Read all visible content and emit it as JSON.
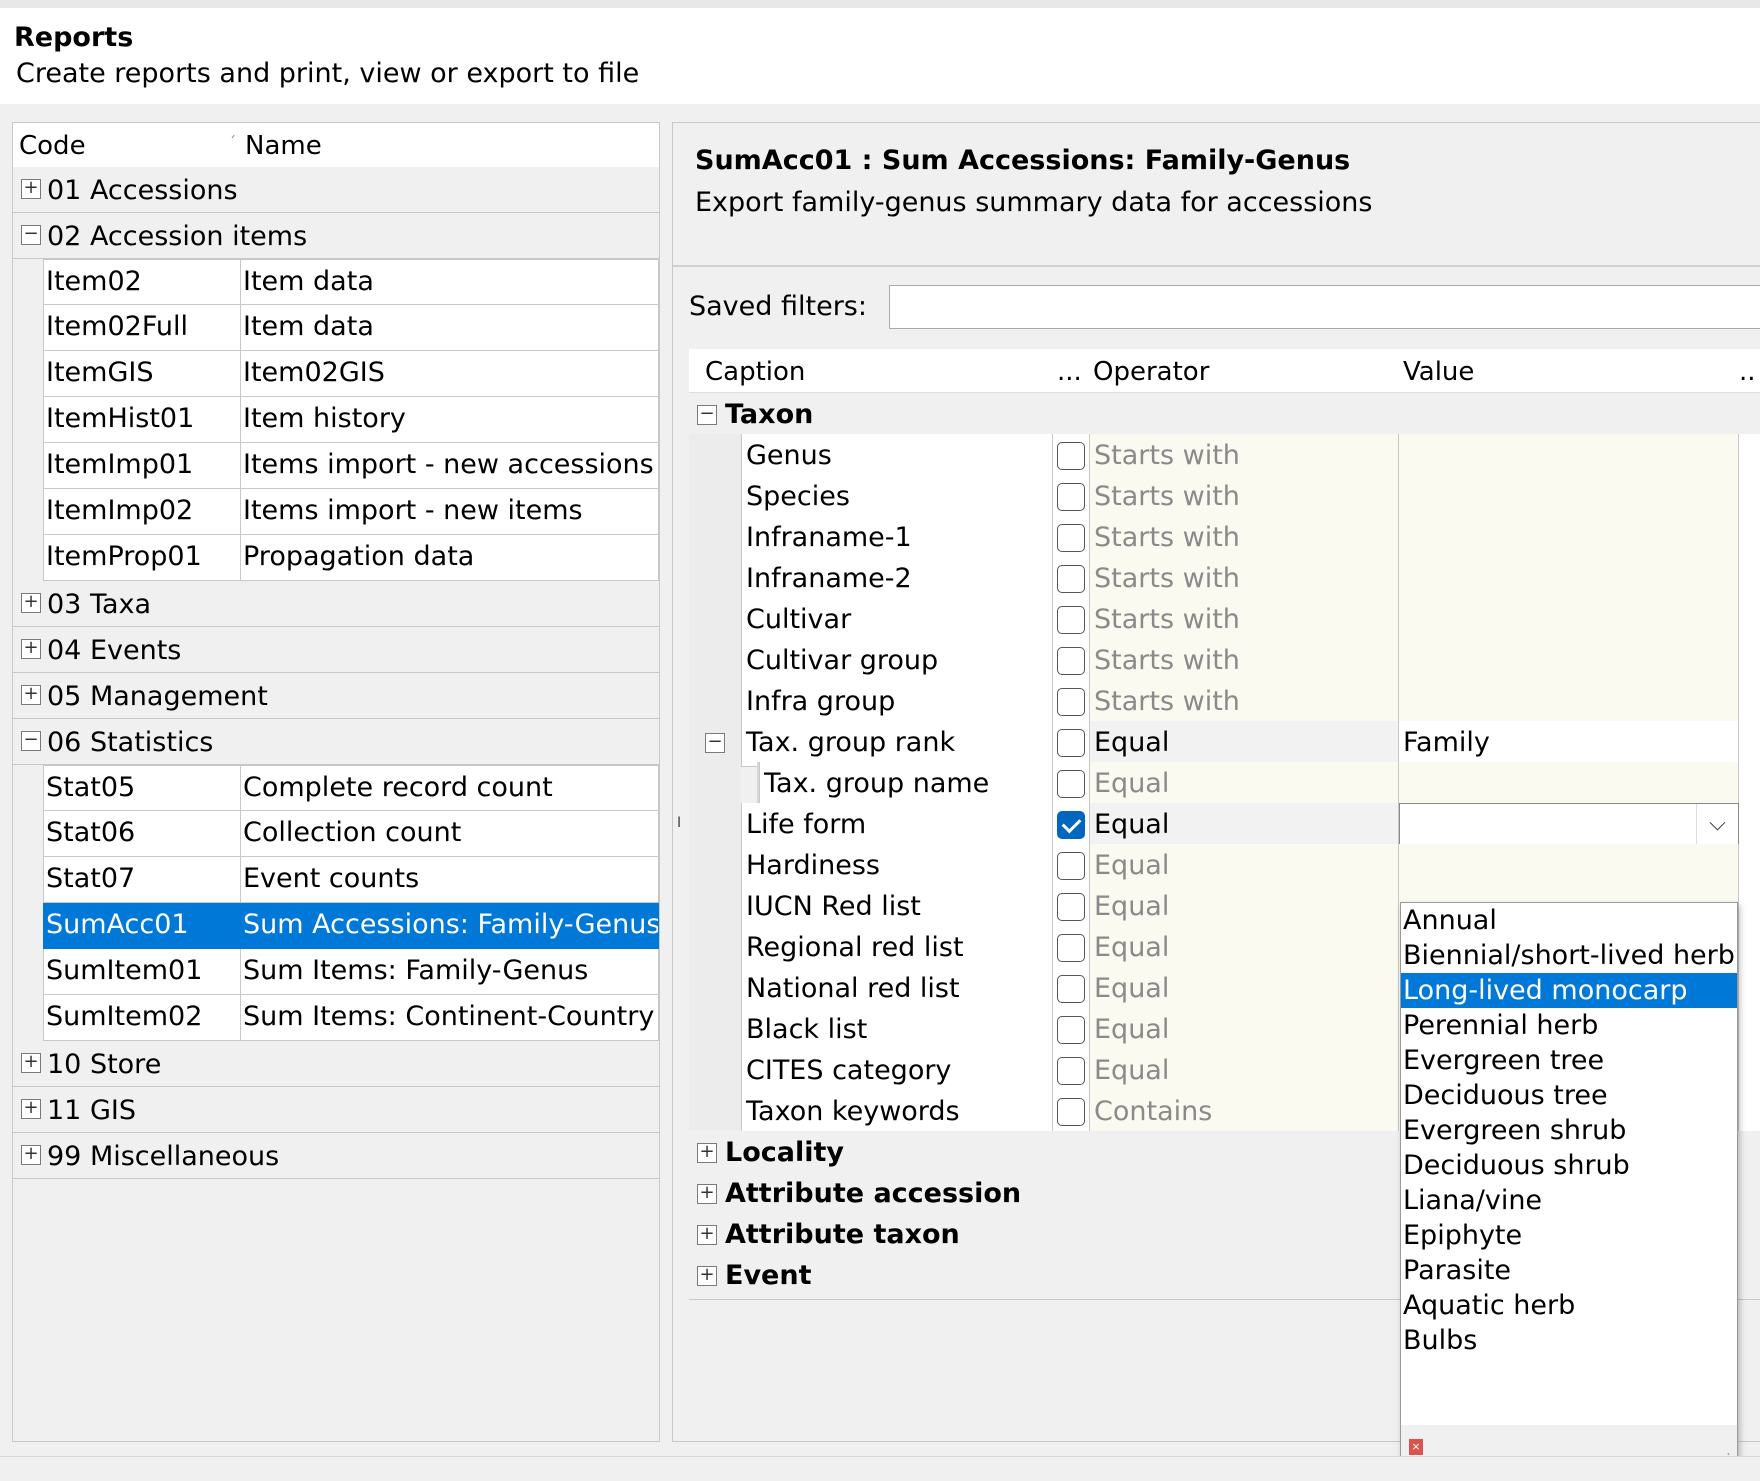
{
  "header": {
    "title": "Reports",
    "subtitle": "Create reports and print, view or export to file"
  },
  "report_list": {
    "columns": {
      "code": "Code",
      "sep": "ˊ",
      "name": "Name"
    },
    "groups": [
      {
        "label": "01 Accessions",
        "expanded": false,
        "items": []
      },
      {
        "label": "02 Accession items",
        "expanded": true,
        "items": [
          {
            "code": "Item02",
            "name": "Item data"
          },
          {
            "code": "Item02Full",
            "name": "Item data"
          },
          {
            "code": "ItemGIS",
            "name": "Item02GIS"
          },
          {
            "code": "ItemHist01",
            "name": "Item history"
          },
          {
            "code": "ItemImp01",
            "name": "Items import - new accessions"
          },
          {
            "code": "ItemImp02",
            "name": "Items import - new items"
          },
          {
            "code": "ItemProp01",
            "name": "Propagation data"
          }
        ]
      },
      {
        "label": "03 Taxa",
        "expanded": false,
        "items": []
      },
      {
        "label": "04 Events",
        "expanded": false,
        "items": []
      },
      {
        "label": "05 Management",
        "expanded": false,
        "items": []
      },
      {
        "label": "06 Statistics",
        "expanded": true,
        "items": [
          {
            "code": "Stat05",
            "name": "Complete record count"
          },
          {
            "code": "Stat06",
            "name": "Collection count"
          },
          {
            "code": "Stat07",
            "name": "Event counts"
          },
          {
            "code": "SumAcc01",
            "name": "Sum Accessions: Family-Genus",
            "selected": true
          },
          {
            "code": "SumItem01",
            "name": "Sum Items: Family-Genus"
          },
          {
            "code": "SumItem02",
            "name": "Sum Items: Continent-Country"
          }
        ]
      },
      {
        "label": "10 Store",
        "expanded": false,
        "items": []
      },
      {
        "label": "11 GIS",
        "expanded": false,
        "items": []
      },
      {
        "label": "99 Miscellaneous",
        "expanded": false,
        "items": []
      }
    ]
  },
  "detail": {
    "title": "SumAcc01 : Sum Accessions: Family-Genus",
    "description": "Export family-genus summary data for accessions",
    "saved_filters_label": "Saved filters:",
    "saved_filters_value": ""
  },
  "filter_grid": {
    "columns": {
      "caption": "Caption",
      "dots": "...",
      "operator": "Operator",
      "value": "Value",
      "dots2": ".."
    },
    "taxon_label": "Taxon",
    "taxon_rows": [
      {
        "caption": "Genus",
        "checked": false,
        "operator": "Starts with",
        "value": ""
      },
      {
        "caption": "Species",
        "checked": false,
        "operator": "Starts with",
        "value": ""
      },
      {
        "caption": "Infraname-1",
        "checked": false,
        "operator": "Starts with",
        "value": ""
      },
      {
        "caption": "Infraname-2",
        "checked": false,
        "operator": "Starts with",
        "value": ""
      },
      {
        "caption": "Cultivar",
        "checked": false,
        "operator": "Starts with",
        "value": ""
      },
      {
        "caption": "Cultivar group",
        "checked": false,
        "operator": "Starts with",
        "value": ""
      },
      {
        "caption": "Infra group",
        "checked": false,
        "operator": "Starts with",
        "value": ""
      },
      {
        "caption": "Tax. group rank",
        "checked": false,
        "operator": "Equal",
        "value": "Family"
      },
      {
        "caption": "Tax. group name",
        "checked": false,
        "operator": "Equal",
        "value": ""
      },
      {
        "caption": "Life form",
        "checked": true,
        "operator": "Equal",
        "value": ""
      },
      {
        "caption": "Hardiness",
        "checked": false,
        "operator": "Equal",
        "value": ""
      },
      {
        "caption": "IUCN Red list",
        "checked": false,
        "operator": "Equal",
        "value": ""
      },
      {
        "caption": "Regional red list",
        "checked": false,
        "operator": "Equal",
        "value": ""
      },
      {
        "caption": "National red list",
        "checked": false,
        "operator": "Equal",
        "value": ""
      },
      {
        "caption": "Black list",
        "checked": false,
        "operator": "Equal",
        "value": ""
      },
      {
        "caption": "CITES category",
        "checked": false,
        "operator": "Equal",
        "value": ""
      },
      {
        "caption": "Taxon keywords",
        "checked": false,
        "operator": "Contains",
        "value": ""
      }
    ],
    "other_categories": [
      "Locality",
      "Attribute accession",
      "Attribute taxon",
      "Event"
    ],
    "cursor_glyph": "I"
  },
  "life_form_dropdown": {
    "options": [
      "Annual",
      "Biennial/short-lived herb",
      "Long-lived monocarp",
      "Perennial herb",
      "Evergreen tree",
      "Deciduous tree",
      "Evergreen shrub",
      "Deciduous shrub",
      "Liana/vine",
      "Epiphyte",
      "Parasite",
      "Aquatic herb",
      "Bulbs"
    ],
    "highlighted": "Long-lived monocarp",
    "chevron_icon": "chevron-down-icon",
    "close_icon": "close-icon",
    "close_glyph": "×",
    "grip_glyph": "⋰"
  },
  "colors": {
    "selection": "#0078d7",
    "checkbox_on": "#0067c0"
  }
}
